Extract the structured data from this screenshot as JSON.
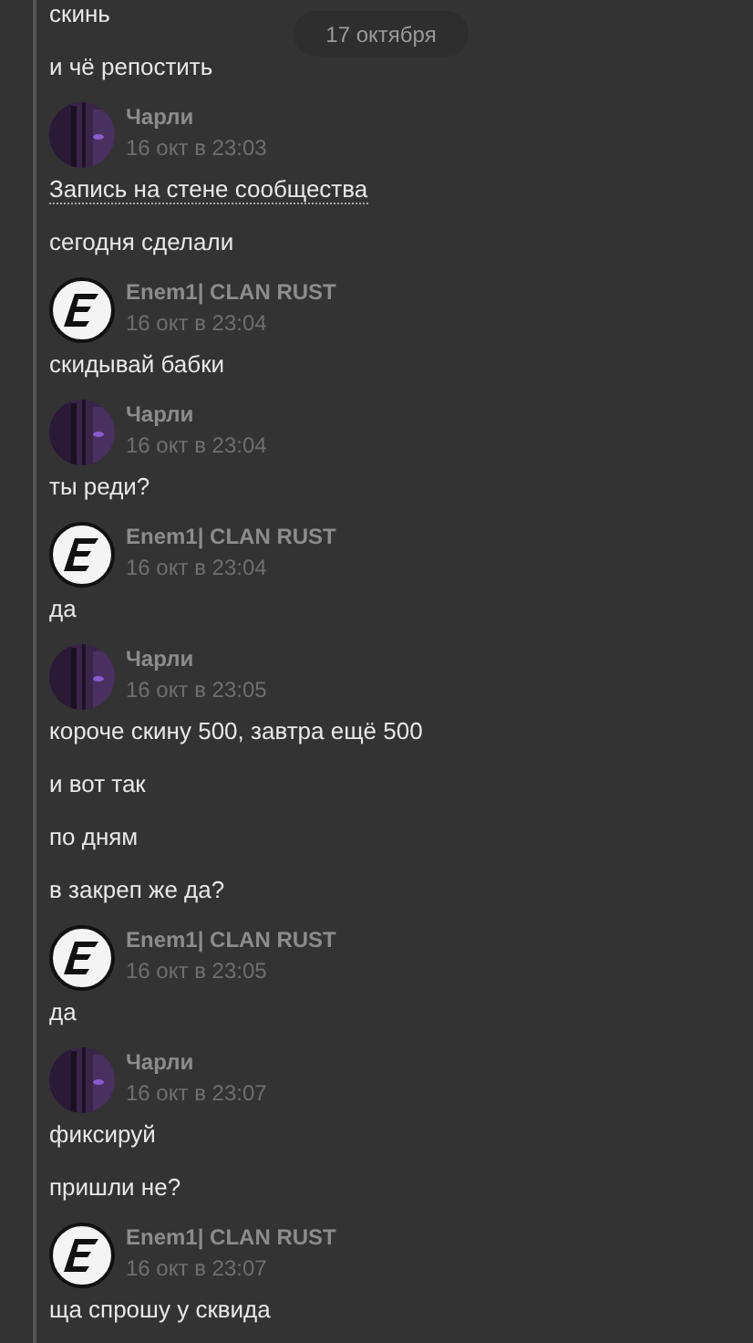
{
  "date_badge": "17 октября",
  "messages": [
    {
      "kind": "text",
      "text": "скинь"
    },
    {
      "kind": "text",
      "text": "и чё репостить"
    },
    {
      "kind": "person",
      "author": "Чарли",
      "time": "16 окт в 23:03"
    },
    {
      "kind": "link",
      "text": "Запись на стене сообщества"
    },
    {
      "kind": "text",
      "text": "сегодня сделали"
    },
    {
      "kind": "logo",
      "author": "Enem1| CLAN RUST",
      "time": "16 окт в 23:04"
    },
    {
      "kind": "text",
      "text": "скидывай бабки"
    },
    {
      "kind": "person",
      "author": "Чарли",
      "time": "16 окт в 23:04"
    },
    {
      "kind": "text",
      "text": "ты реди?"
    },
    {
      "kind": "logo",
      "author": "Enem1| CLAN RUST",
      "time": "16 окт в 23:04"
    },
    {
      "kind": "text",
      "text": "да"
    },
    {
      "kind": "person",
      "author": "Чарли",
      "time": "16 окт в 23:05"
    },
    {
      "kind": "text",
      "text": "короче скину 500, завтра ещё 500"
    },
    {
      "kind": "text",
      "text": "и вот так"
    },
    {
      "kind": "text",
      "text": "по дням"
    },
    {
      "kind": "text",
      "text": "в закреп же да?"
    },
    {
      "kind": "logo",
      "author": "Enem1| CLAN RUST",
      "time": "16 окт в 23:05"
    },
    {
      "kind": "text",
      "text": "да"
    },
    {
      "kind": "person",
      "author": "Чарли",
      "time": "16 окт в 23:07"
    },
    {
      "kind": "text",
      "text": "фиксируй"
    },
    {
      "kind": "text",
      "text": "пришли не?"
    },
    {
      "kind": "logo",
      "author": "Enem1| CLAN RUST",
      "time": "16 окт в 23:07"
    },
    {
      "kind": "text",
      "text": "ща спрошу у сквида"
    }
  ]
}
